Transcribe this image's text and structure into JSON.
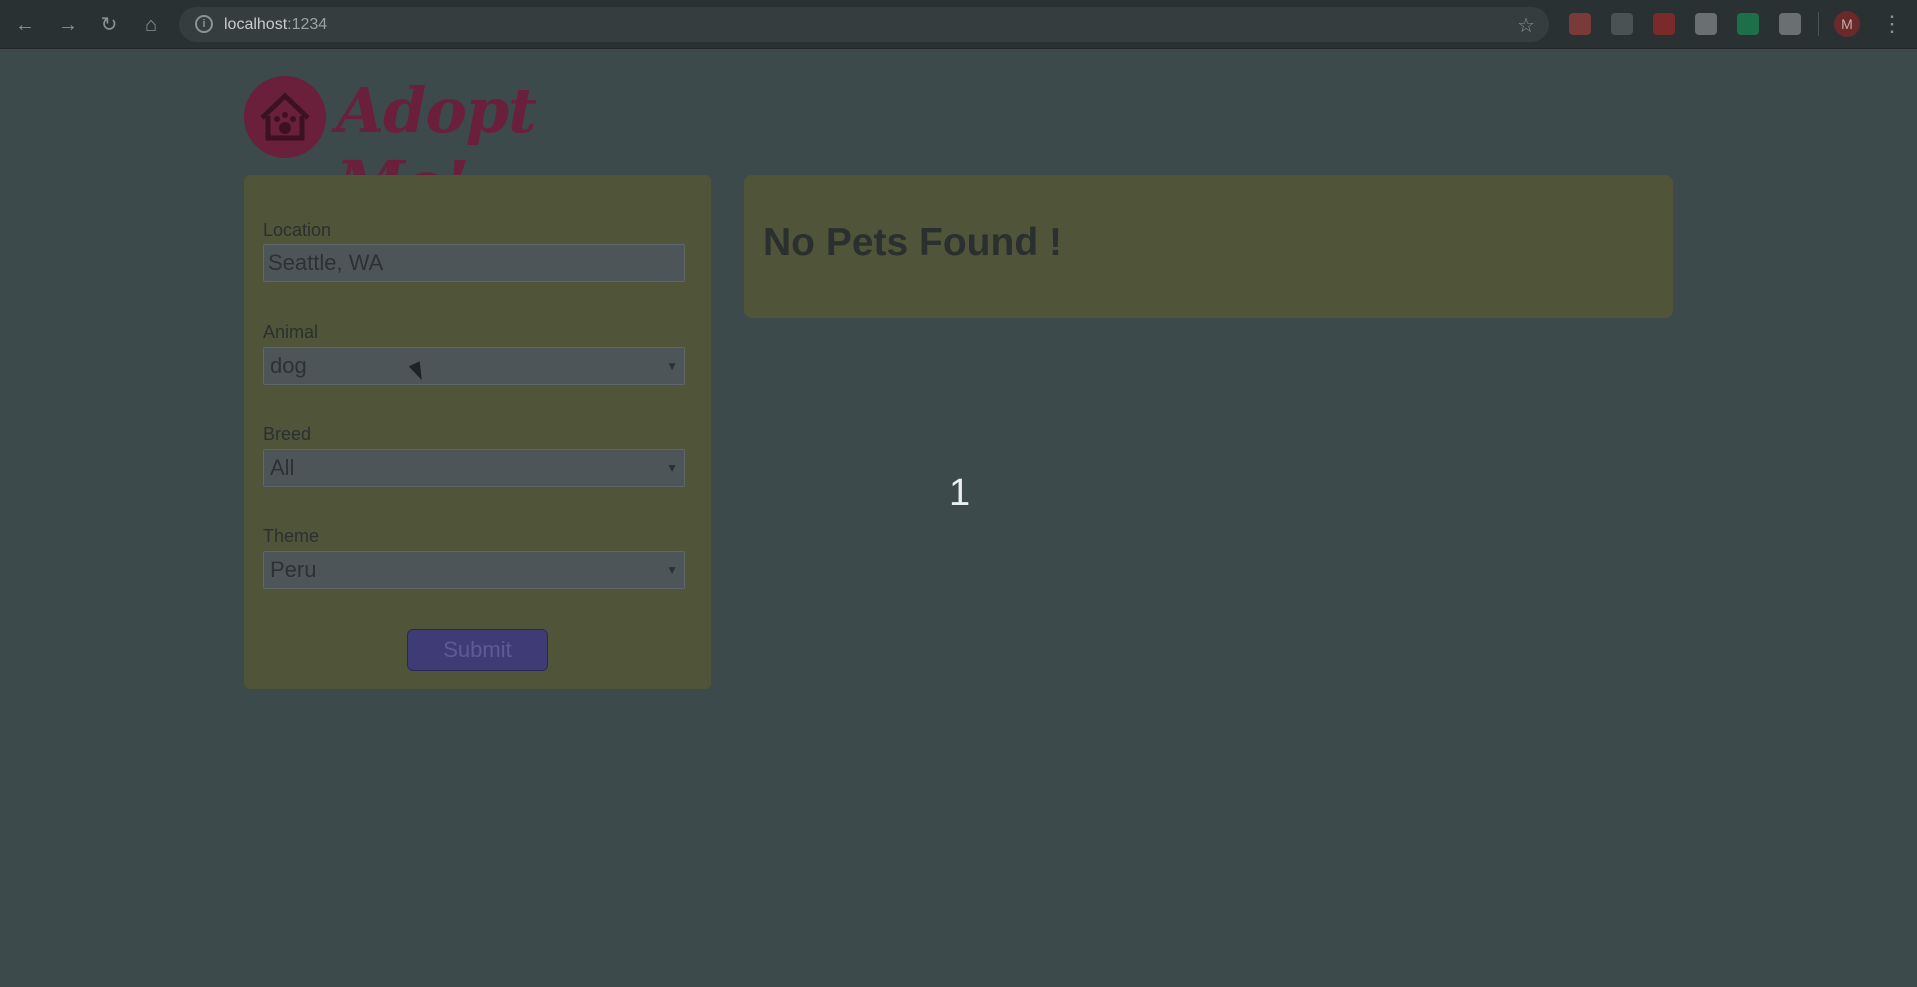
{
  "browser": {
    "url_host": "localhost",
    "url_port": ":1234",
    "profile_initial": "M",
    "extensions": [
      {
        "name": "extension-red-icon",
        "color": "#7a3a3a"
      },
      {
        "name": "extension-s-icon",
        "color": "#4a5254"
      },
      {
        "name": "extension-bug-icon",
        "color": "#7a2a2a"
      },
      {
        "name": "extension-gray-icon",
        "color": "#6a7072"
      },
      {
        "name": "extension-green-icon",
        "color": "#1f6e4a"
      },
      {
        "name": "extension-camera-icon",
        "color": "#6a7072"
      }
    ]
  },
  "logo": {
    "text": "Adopt Me!"
  },
  "search": {
    "location_label": "Location",
    "location_value": "Seattle, WA",
    "animal_label": "Animal",
    "animal_value": "dog",
    "breed_label": "Breed",
    "breed_value": "All",
    "theme_label": "Theme",
    "theme_value": "Peru",
    "submit_label": "Submit"
  },
  "results": {
    "title": "No Pets Found !"
  },
  "counter": "1",
  "colors": {
    "panel": "#50553a",
    "accent": "#6a1f3a",
    "button": "#3f3b76",
    "background": "#3c4a4b"
  }
}
